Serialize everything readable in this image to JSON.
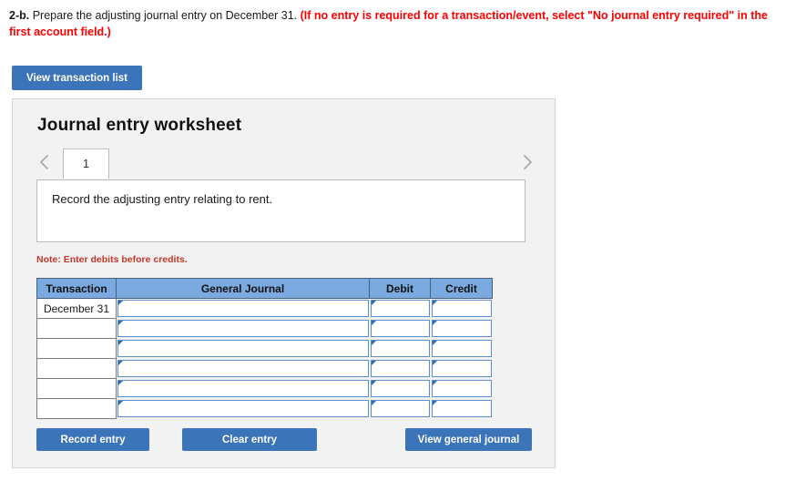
{
  "question": {
    "label": "2-b.",
    "text": " Prepare the adjusting journal entry on December 31. ",
    "note": "(If no entry is required for a transaction/event, select \"No journal entry required\" in the first account field.)"
  },
  "toolbar": {
    "view_transaction_list_label": "View transaction list"
  },
  "worksheet": {
    "title": "Journal entry worksheet",
    "prev_icon": "chevron-left-icon",
    "next_icon": "chevron-right-icon",
    "tabs": [
      {
        "label": "1",
        "active": true
      }
    ],
    "instruction": "Record the adjusting entry relating to rent.",
    "note": "Note: Enter debits before credits.",
    "table": {
      "columns": [
        "Transaction",
        "General Journal",
        "Debit",
        "Credit"
      ],
      "rows": [
        {
          "transaction": "December 31",
          "general_journal": "",
          "debit": "",
          "credit": ""
        },
        {
          "transaction": "",
          "general_journal": "",
          "debit": "",
          "credit": ""
        },
        {
          "transaction": "",
          "general_journal": "",
          "debit": "",
          "credit": ""
        },
        {
          "transaction": "",
          "general_journal": "",
          "debit": "",
          "credit": ""
        },
        {
          "transaction": "",
          "general_journal": "",
          "debit": "",
          "credit": ""
        },
        {
          "transaction": "",
          "general_journal": "",
          "debit": "",
          "credit": ""
        }
      ]
    },
    "actions": {
      "record_entry_label": "Record entry",
      "clear_entry_label": "Clear entry",
      "view_general_journal_label": "View general journal"
    }
  },
  "colors": {
    "button_blue": "#3b74b8",
    "table_header_blue": "#7aaae0",
    "note_red": "#c0392b",
    "question_red": "#ff0000",
    "panel_gray": "#f2f2f2",
    "input_border_blue": "#5b8fc9"
  }
}
